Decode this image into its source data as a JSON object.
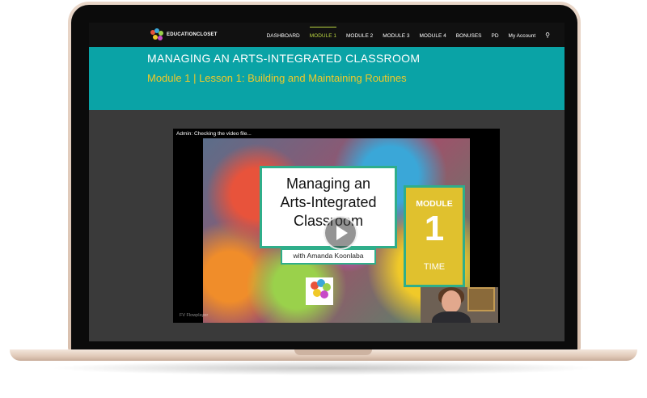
{
  "nav": {
    "logo_text": "EDUCATIONCLOSET",
    "items": [
      "DASHBOARD",
      "MODULE 1",
      "MODULE 2",
      "MODULE 3",
      "MODULE 4",
      "BONUSES",
      "PD",
      "My Account"
    ],
    "active_index": 1,
    "search_icon": "search-icon"
  },
  "banner": {
    "title": "MANAGING AN ARTS-INTEGRATED CLASSROOM",
    "subtitle": "Module 1  |  Lesson 1: Building and Maintaining Routines"
  },
  "video": {
    "status": "Admin: Checking the video file...",
    "title_line1": "Managing an",
    "title_line2": "Arts-Integrated",
    "title_line3": "Classroom",
    "presenter": "with Amanda Koonlaba",
    "module_label": "MODULE",
    "module_number": "1",
    "module_footer": "TIME",
    "watermark": "FV Flowplayer"
  },
  "colors": {
    "nav_bg": "#111111",
    "nav_active": "#b8d340",
    "banner_bg": "#0aa3a6",
    "subtitle": "#f0c929",
    "laptop_body": "#e2cab8"
  }
}
